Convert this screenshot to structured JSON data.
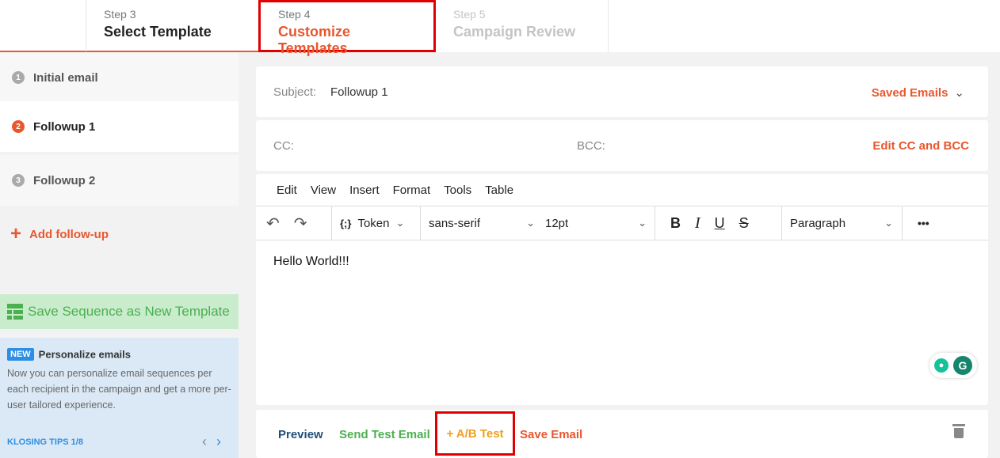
{
  "steps": [
    {
      "num": "Step 3",
      "title": "Select Template"
    },
    {
      "num": "Step 4",
      "title": "Customize Templates"
    },
    {
      "num": "Step 5",
      "title": "Campaign Review"
    }
  ],
  "sequence": [
    {
      "badge": "1",
      "label": "Initial email"
    },
    {
      "badge": "2",
      "label": "Followup 1"
    },
    {
      "badge": "3",
      "label": "Followup 2"
    }
  ],
  "add_followup": "Add follow-up",
  "save_sequence": "Save Sequence as New Template",
  "tips": {
    "badge": "NEW",
    "title": "Personalize emails",
    "body": "Now you can personalize email sequences per each recipient in the campaign and get a more per-user tailored experience.",
    "footer": "KLOSING TIPS 1/8"
  },
  "subject": {
    "label": "Subject:",
    "value": "Followup 1",
    "saved": "Saved Emails"
  },
  "cc": {
    "cc_label": "CC:",
    "bcc_label": "BCC:",
    "edit": "Edit CC and BCC"
  },
  "editor": {
    "menu": [
      "Edit",
      "View",
      "Insert",
      "Format",
      "Tools",
      "Table"
    ],
    "token_icon": "{;}",
    "token": "Token",
    "font": "sans-serif",
    "size": "12pt",
    "block": "Paragraph",
    "bold": "B",
    "italic": "I",
    "underline": "U",
    "strike": "S",
    "more": "•••",
    "content": "Hello World!!!"
  },
  "actions": {
    "preview": "Preview",
    "test": "Send Test Email",
    "ab": "+ A/B Test",
    "save": "Save Email"
  }
}
